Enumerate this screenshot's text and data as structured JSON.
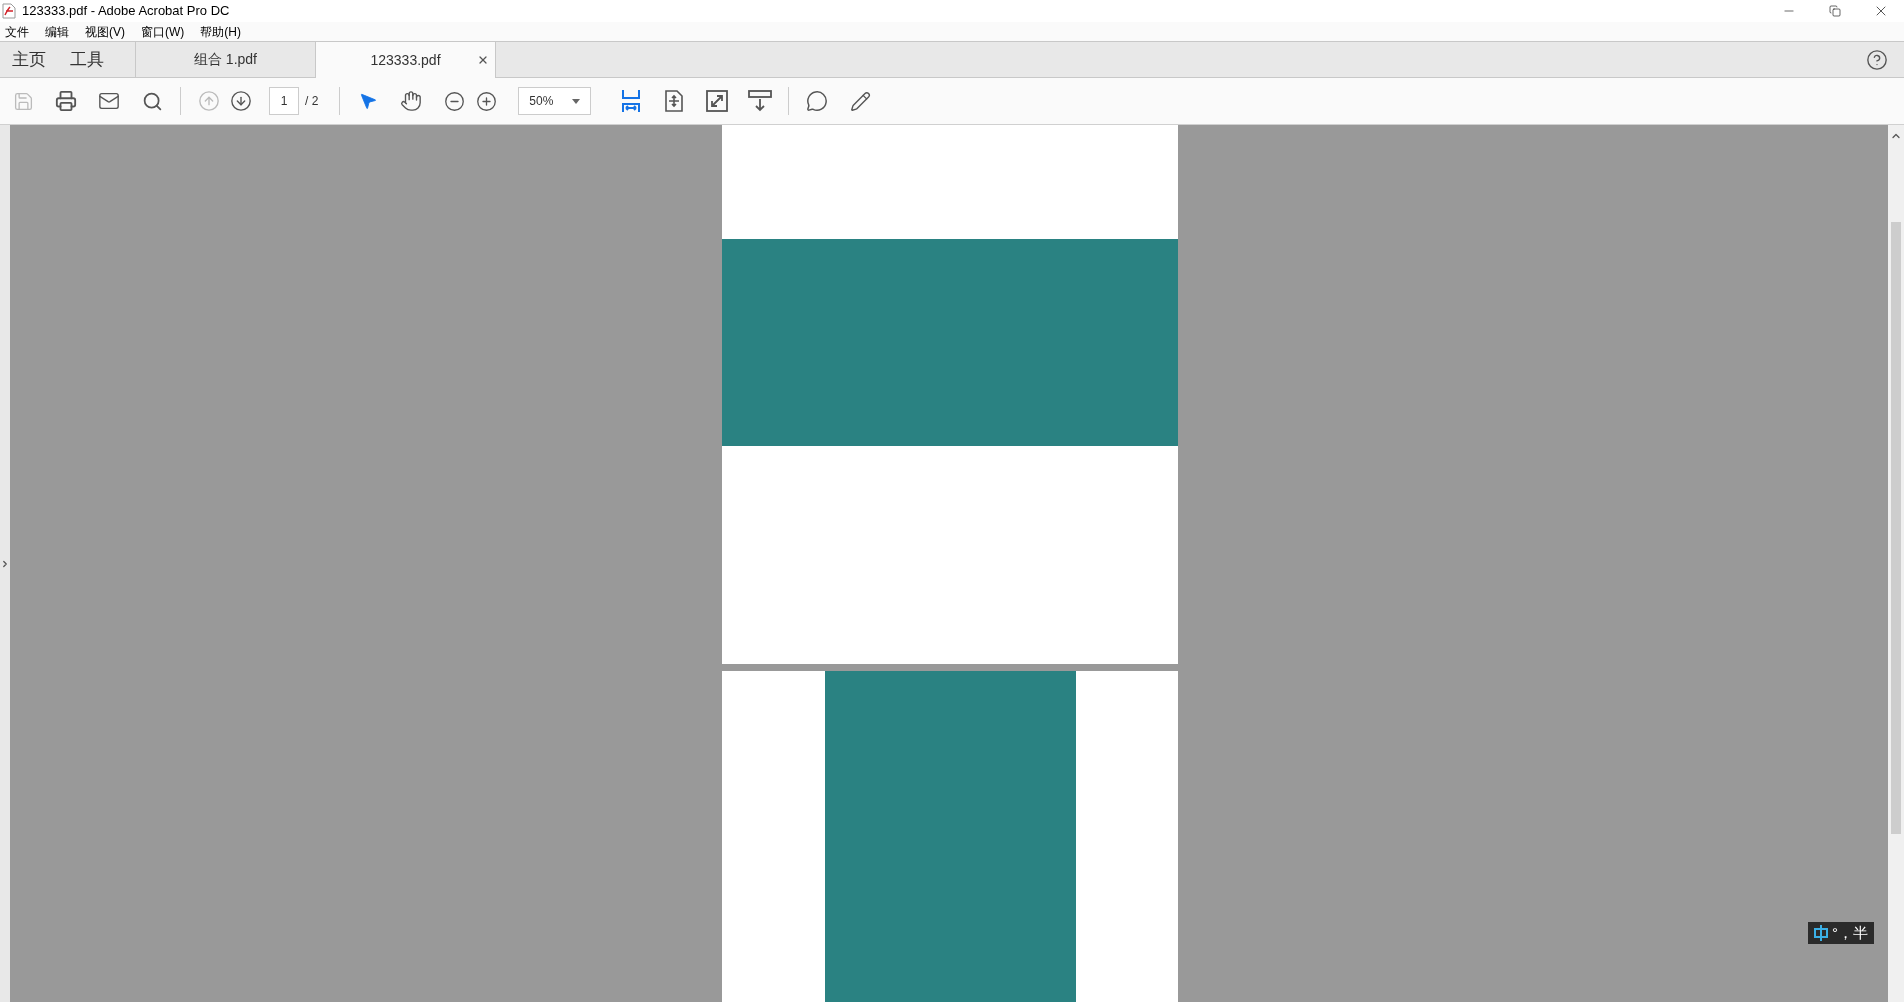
{
  "window": {
    "title": "123333.pdf - Adobe Acrobat Pro DC"
  },
  "menu": [
    "文件",
    "编辑",
    "视图(V)",
    "窗口(W)",
    "帮助(H)"
  ],
  "nav_tabs": [
    "主页",
    "工具"
  ],
  "doc_tabs": [
    {
      "label": "组合 1.pdf",
      "selected": false
    },
    {
      "label": "123333.pdf",
      "selected": true
    }
  ],
  "toolbar": {
    "page_input": "1",
    "page_total": "/ 2",
    "zoom": "50%"
  },
  "ime": {
    "text": "°，半"
  }
}
